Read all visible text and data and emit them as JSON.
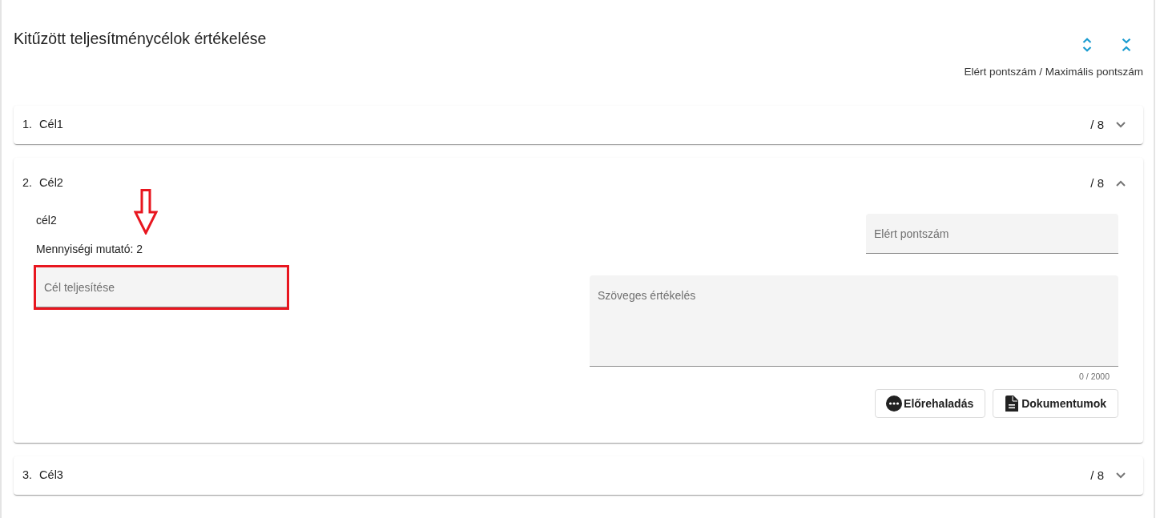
{
  "page": {
    "title": "Kitűzött teljesítménycélok értékelése",
    "score_header": "Elért pontszám / Maximális pontszám"
  },
  "goals": [
    {
      "number": "1.",
      "name": "Cél1",
      "score": "/ 8",
      "expanded": false
    },
    {
      "number": "2.",
      "name": "Cél2",
      "score": "/ 8",
      "expanded": true,
      "description": "cél2",
      "quantity_indicator": "Mennyiségi mutató: 2",
      "completion_field": {
        "placeholder": "Cél teljesítése",
        "highlighted": true
      },
      "score_field": {
        "placeholder": "Elért pontszám"
      },
      "text_evaluation": {
        "placeholder": "Szöveges értékelés",
        "counter": "0 / 2000"
      },
      "buttons": [
        {
          "label": "Előrehaladás",
          "kind": "progress"
        },
        {
          "label": "Dokumentumok",
          "kind": "documents"
        }
      ],
      "annotations": [
        {
          "kind": "arrow"
        }
      ]
    },
    {
      "number": "3.",
      "name": "Cél3",
      "score": "/ 8",
      "expanded": false
    }
  ]
}
